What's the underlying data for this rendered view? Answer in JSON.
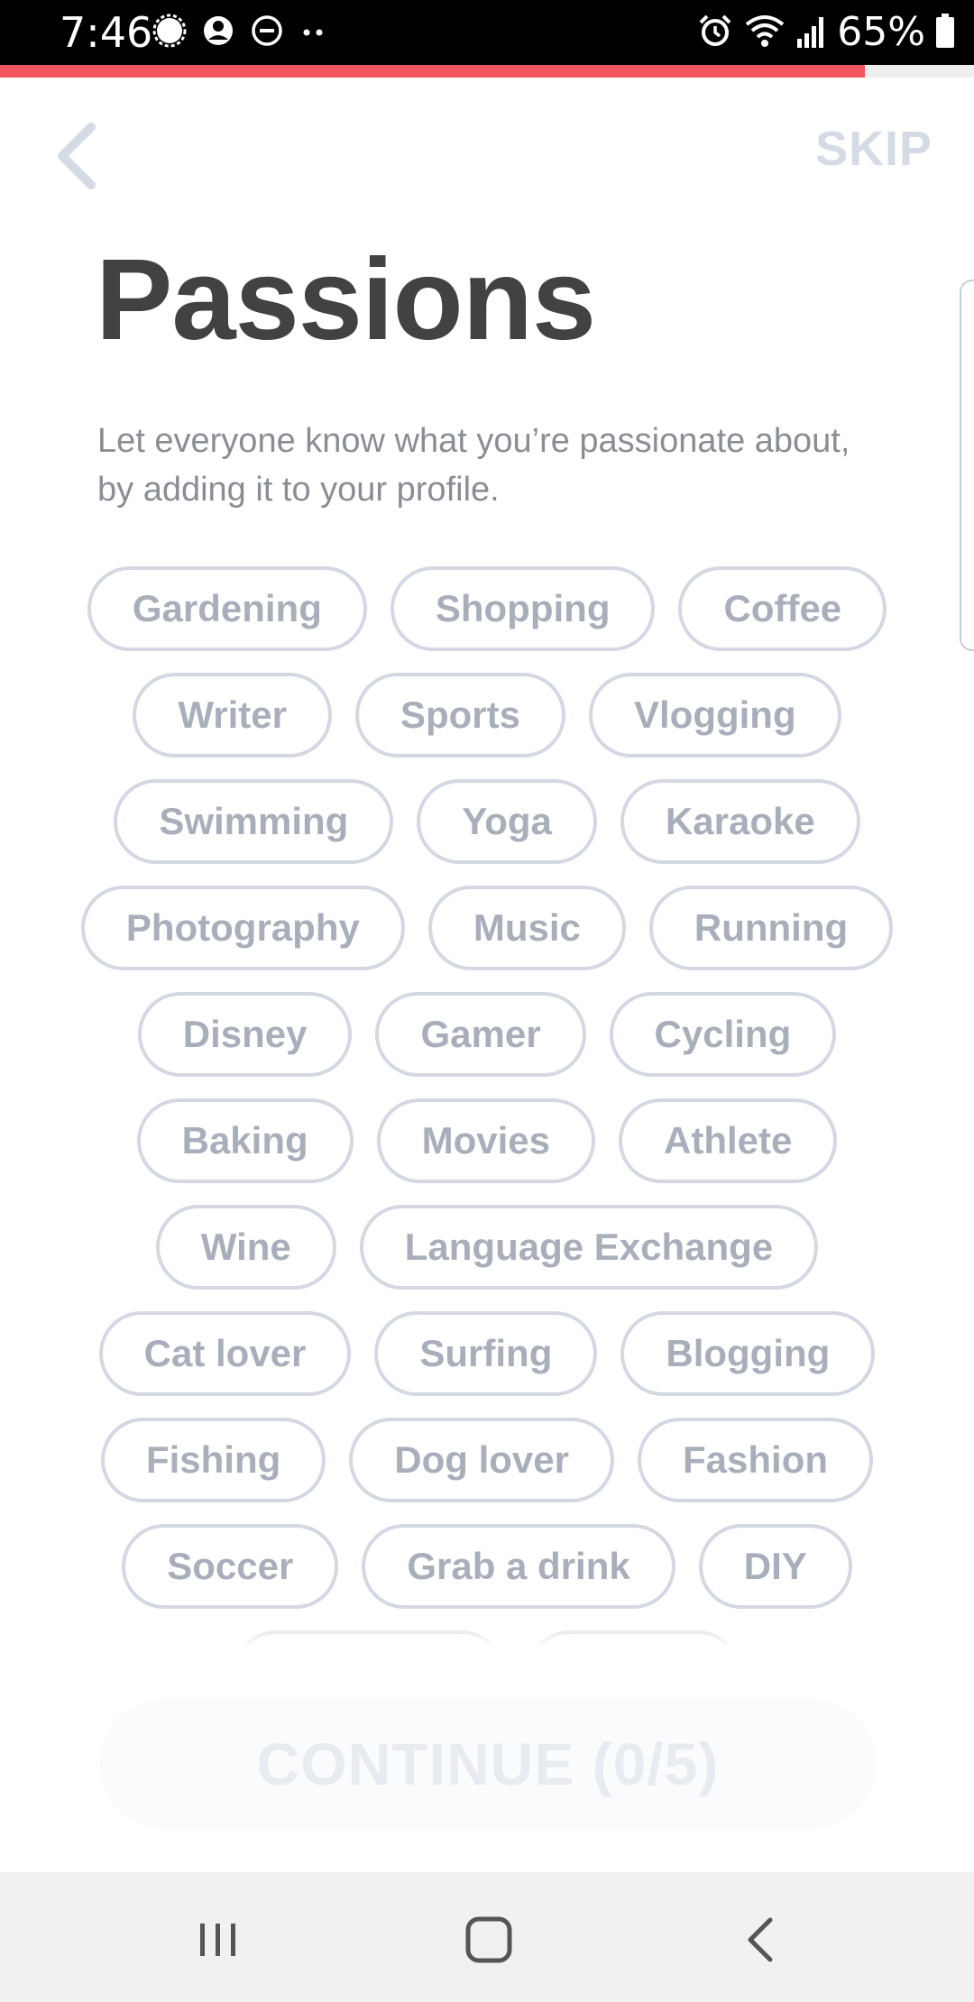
{
  "status_bar": {
    "time": "7:46",
    "battery": "65%",
    "left_icons": [
      "chat-bubble-icon",
      "account-circle-icon",
      "do-not-disturb-icon",
      "more-dots-icon"
    ],
    "right_icons": [
      "alarm-icon",
      "wifi-icon",
      "signal-icon",
      "battery-icon"
    ]
  },
  "progress": {
    "fraction": 0.888,
    "color": "#f2575f"
  },
  "header": {
    "skip_label": "SKIP"
  },
  "title": "Passions",
  "subtitle": "Let everyone know what you’re passionate about, by adding it to your profile.",
  "passions": [
    [
      "Gardening",
      "Shopping",
      "Coffee"
    ],
    [
      "Writer",
      "Sports",
      "Vlogging"
    ],
    [
      "Swimming",
      "Yoga",
      "Karaoke"
    ],
    [
      "Photography",
      "Music",
      "Running"
    ],
    [
      "Disney",
      "Gamer",
      "Cycling"
    ],
    [
      "Baking",
      "Movies",
      "Athlete"
    ],
    [
      "Wine",
      "Language Exchange"
    ],
    [
      "Cat lover",
      "Surfing",
      "Blogging"
    ],
    [
      "Fishing",
      "Dog lover",
      "Fashion"
    ],
    [
      "Soccer",
      "Grab a drink",
      "DIY"
    ]
  ],
  "continue_label": "CONTINUE (0/5)",
  "colors": {
    "accent": "#f2575f",
    "title": "#424242",
    "chip_text": "#a9aebb",
    "chip_border": "#d4d8e2"
  },
  "nav_bar": {
    "icons": [
      "recent-apps-icon",
      "home-icon",
      "back-icon"
    ]
  }
}
